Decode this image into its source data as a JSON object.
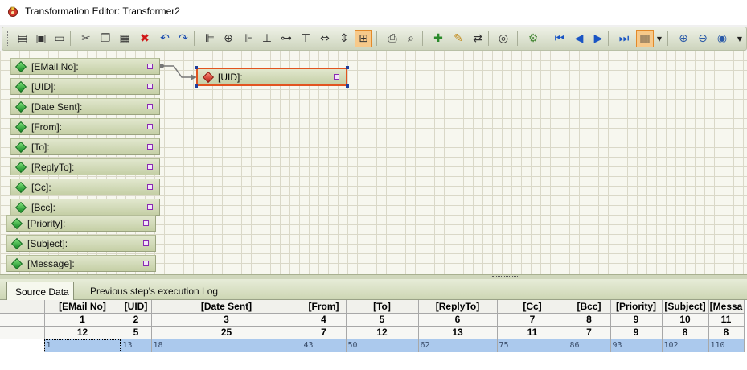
{
  "window": {
    "title": "Transformation Editor: Transformer2",
    "icon": "transformer-app-icon"
  },
  "toolbar": {
    "buttons": [
      {
        "icon": "properties-icon",
        "label": "Properties"
      },
      {
        "icon": "save-icon",
        "label": "Save"
      },
      {
        "icon": "save-as-icon",
        "label": "Save As"
      },
      {
        "icon": "cut-icon",
        "label": "Cut"
      },
      {
        "icon": "copy-icon",
        "label": "Copy"
      },
      {
        "icon": "paste-icon",
        "label": "Paste"
      },
      {
        "icon": "delete-icon",
        "label": "Delete"
      },
      {
        "icon": "undo-icon",
        "label": "Undo"
      },
      {
        "icon": "redo-icon",
        "label": "Redo"
      },
      {
        "icon": "align-left-icon",
        "label": "Align Left"
      },
      {
        "icon": "align-center-icon",
        "label": "Align Center"
      },
      {
        "icon": "align-right-icon",
        "label": "Align Right"
      },
      {
        "icon": "align-bottom-icon",
        "label": "Align Bottom"
      },
      {
        "icon": "align-middle-icon",
        "label": "Align Middle"
      },
      {
        "icon": "align-top-icon",
        "label": "Align Top"
      },
      {
        "icon": "same-width-icon",
        "label": "Same Width"
      },
      {
        "icon": "same-height-icon",
        "label": "Same Height"
      },
      {
        "icon": "same-size-icon",
        "label": "Same Size"
      },
      {
        "icon": "print-icon",
        "label": "Print"
      },
      {
        "icon": "print-preview-icon",
        "label": "Print Preview"
      },
      {
        "icon": "add-field-icon",
        "label": "Add Field"
      },
      {
        "icon": "clear-icon",
        "label": "Clear"
      },
      {
        "icon": "map-fields-icon",
        "label": "Map Fields"
      },
      {
        "icon": "find-icon",
        "label": "Find"
      },
      {
        "icon": "run-icon",
        "label": "Run"
      },
      {
        "icon": "first-record-icon",
        "label": "First"
      },
      {
        "icon": "previous-record-icon",
        "label": "Previous"
      },
      {
        "icon": "next-record-icon",
        "label": "Next"
      },
      {
        "icon": "last-record-icon",
        "label": "Last"
      },
      {
        "icon": "show-data-icon",
        "label": "Show Data"
      },
      {
        "icon": "zoom-in-icon",
        "label": "Zoom In"
      },
      {
        "icon": "zoom-out-icon",
        "label": "Zoom Out"
      },
      {
        "icon": "zoom-reset-icon",
        "label": "Zoom Reset"
      }
    ]
  },
  "canvas": {
    "source_fields": [
      "[EMail No]:",
      "[UID]:",
      "[Date Sent]:",
      "[From]:",
      "[To]:",
      "[ReplyTo]:",
      "[Cc]:",
      "[Bcc]:",
      "[Priority]:",
      "[Subject]:",
      "[Message]:"
    ],
    "target_field": "[UID]:",
    "colors": {
      "selection_border": "#e2531f",
      "source_icon": "#1a9a2a",
      "target_icon": "#c0281a",
      "port": "#8a2ab2"
    }
  },
  "tabs": [
    {
      "label": "Source Data",
      "active": true
    },
    {
      "label": "Previous step's execution Log",
      "active": false
    }
  ],
  "grid": {
    "columns": [
      "[EMail No]",
      "[UID]",
      "[Date Sent]",
      "[From]",
      "[To]",
      "[ReplyTo]",
      "[Cc]",
      "[Bcc]",
      "[Priority]",
      "[Subject]",
      "[Messa"
    ],
    "index_row": [
      "1",
      "2",
      "3",
      "4",
      "5",
      "6",
      "7",
      "8",
      "9",
      "10",
      "11"
    ],
    "length_row": [
      "12",
      "5",
      "25",
      "7",
      "12",
      "13",
      "11",
      "7",
      "9",
      "8",
      "8"
    ],
    "rows": [
      [
        "1",
        "13",
        "18",
        "43",
        "50",
        "62",
        "75",
        "86",
        "93",
        "102",
        "110"
      ]
    ],
    "selection_color": "#abc9ed"
  }
}
